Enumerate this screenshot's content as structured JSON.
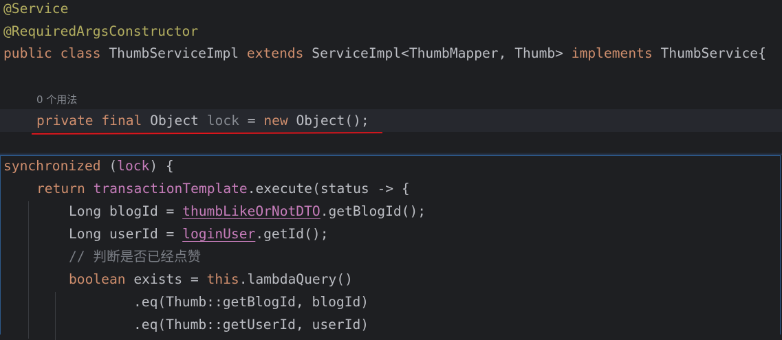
{
  "top_panel": {
    "lines": [
      {
        "a1": "@Service"
      },
      {
        "a1": "@RequiredArgsConstructor"
      },
      {
        "k1": "public",
        "k2": "class",
        "t1": "ThumbServiceImpl",
        "k3": "extends",
        "t2": "ServiceImpl<ThumbMapper, Thumb>",
        "k4": "implements",
        "t3": "ThumbService{"
      },
      {
        "hint": "0 个用法"
      },
      {
        "k1": "private",
        "k2": "final",
        "t1": "Object",
        "u1": "lock",
        "t2": "=",
        "k3": "new",
        "t3": "Object();"
      }
    ]
  },
  "bottom_panel": {
    "lines": [
      {
        "k1": "synchronized",
        "t1": "(",
        "f1": "lock",
        "t2": ") {"
      },
      {
        "k1": "return",
        "f1": "transactionTemplate",
        "t1": ".execute(status -> {"
      },
      {
        "t1": "Long blogId = ",
        "f1": "thumbLikeOrNotDTO",
        "t2": ".getBlogId();"
      },
      {
        "t1": "Long userId = ",
        "f1": "loginUser",
        "t2": ".getId();"
      },
      {
        "c1": "// 判断是否已经点赞"
      },
      {
        "k1": "boolean",
        "t1": "exists = ",
        "k2": "this",
        "t2": ".lambdaQuery()"
      },
      {
        "t1": ".eq(Thumb::getBlogId, blogId)"
      },
      {
        "t1": ".eq(Thumb::getUserId, userId)"
      }
    ]
  },
  "colors": {
    "background": "#1e1f22",
    "keyword": "#cf8e6d",
    "annotation": "#b3ae60",
    "field": "#c77dbb",
    "comment": "#7a7e85",
    "red_underline": "#e0161d",
    "panel_border": "#2d5a8c"
  }
}
